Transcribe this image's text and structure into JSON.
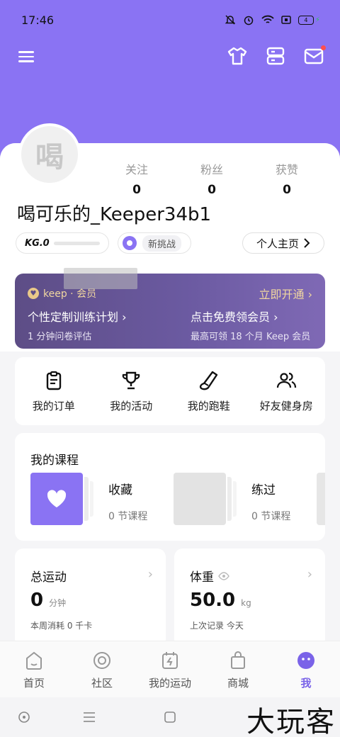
{
  "status_bar": {
    "time": "17:46",
    "battery": "4"
  },
  "profile": {
    "avatar_char": "喝",
    "username": "喝可乐的_Keeper34b1",
    "stats": [
      {
        "label": "关注",
        "value": "0"
      },
      {
        "label": "粉丝",
        "value": "0"
      },
      {
        "label": "获赞",
        "value": "0"
      }
    ],
    "kg_level": "KG.0",
    "challenge_label": "新挑战",
    "homepage_label": "个人主页"
  },
  "membership": {
    "brand": "keep · 会员",
    "open_label": "立即开通",
    "items": [
      {
        "main": "个性定制训练计划",
        "sub": "1 分钟问卷评估"
      },
      {
        "main": "点击免费领会员",
        "sub": "最高可领 18 个月 Keep 会员"
      }
    ]
  },
  "quick_actions": [
    {
      "label": "我的订单",
      "icon": "clipboard-icon"
    },
    {
      "label": "我的活动",
      "icon": "trophy-icon"
    },
    {
      "label": "我的跑鞋",
      "icon": "shoe-icon"
    },
    {
      "label": "好友健身房",
      "icon": "friends-icon"
    }
  ],
  "courses": {
    "title": "我的课程",
    "items": [
      {
        "name": "收藏",
        "count": "0 节课程",
        "icon": "heart-icon"
      },
      {
        "name": "练过",
        "count": "0 节课程",
        "icon": ""
      }
    ]
  },
  "total_exercise": {
    "title": "总运动",
    "value": "0",
    "unit": "分钟",
    "sub": "本周消耗 0 千卡"
  },
  "weight": {
    "title": "体重",
    "value": "50.0",
    "unit": "kg",
    "sub": "上次记录 今天"
  },
  "tabs": [
    {
      "label": "首页",
      "icon": "home-icon"
    },
    {
      "label": "社区",
      "icon": "community-icon"
    },
    {
      "label": "我的运动",
      "icon": "calendar-bolt-icon"
    },
    {
      "label": "商城",
      "icon": "shopping-bag-icon"
    },
    {
      "label": "我",
      "icon": "me-icon"
    }
  ],
  "watermark": "大玩客",
  "colors": {
    "accent": "#8a73f3",
    "member_gold": "#f1d7a0",
    "member_bg": "#6b5aa1"
  }
}
